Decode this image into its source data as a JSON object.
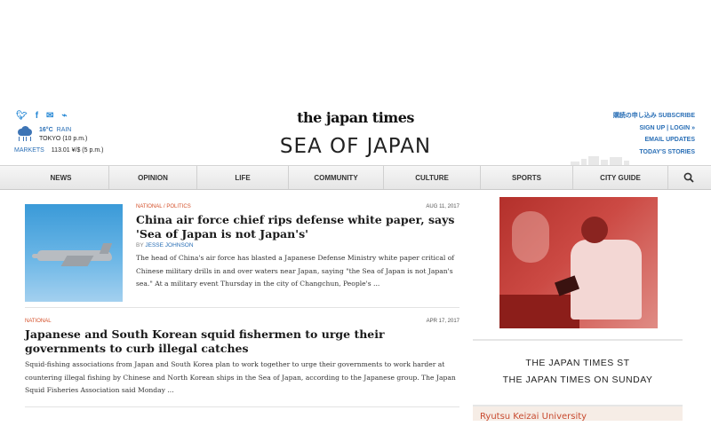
{
  "header": {
    "logo": "the japan times",
    "section_title": "SEA OF JAPAN",
    "social": [
      {
        "icon": "twitter-icon",
        "glyph": "🐦"
      },
      {
        "icon": "facebook-icon",
        "glyph": "f"
      },
      {
        "icon": "email-icon",
        "glyph": "✉"
      },
      {
        "icon": "rss-icon",
        "glyph": "⦾"
      }
    ],
    "weather": {
      "temp": "16°C",
      "condition": "RAIN",
      "location": "TOKYO (10 p.m.)"
    },
    "markets": {
      "label": "MARKETS",
      "value": "113.01 ¥/$ (5 p.m.)"
    },
    "links": {
      "subscribe": "購読の申し込み SUBSCRIBE",
      "signup": "SIGN UP | LOGIN »",
      "email": "EMAIL UPDATES",
      "todays": "TODAY'S STORIES"
    }
  },
  "nav": {
    "items": [
      "NEWS",
      "OPINION",
      "LIFE",
      "COMMUNITY",
      "CULTURE",
      "SPORTS",
      "CITY GUIDE"
    ],
    "search_icon": "search-icon"
  },
  "articles": [
    {
      "category": "NATIONAL",
      "subcategory": "POLITICS",
      "separator": " / ",
      "date": "AUG 11, 2017",
      "headline": "China air force chief rips defense white paper, says 'Sea of Japan is not Japan's'",
      "byline_prefix": "BY ",
      "author": "JESSE JOHNSON",
      "summary": "The head of China's air force has blasted a Japanese Defense Ministry white paper critical of Chinese military drills in and over waters near Japan, saying \"the Sea of Japan is not Japan's sea.\" At a military event Thursday in the city of Changchun, People's ..."
    },
    {
      "category": "NATIONAL",
      "date": "APR 17, 2017",
      "headline": "Japanese and South Korean squid fishermen to urge their governments to curb illegal catches",
      "summary": "Squid-fishing associations from Japan and South Korea plan to work together to urge their governments to work harder at countering illegal fishing by Chinese and North Korean ships in the Sea of Japan, according to the Japanese group. The Japan Squid Fisheries Association said Monday ..."
    }
  ],
  "sidebar": {
    "box_line1": "THE JAPAN TIMES ST",
    "box_line2": "THE JAPAN TIMES ON SUNDAY",
    "promo": "Ryutsu Keizai University"
  }
}
